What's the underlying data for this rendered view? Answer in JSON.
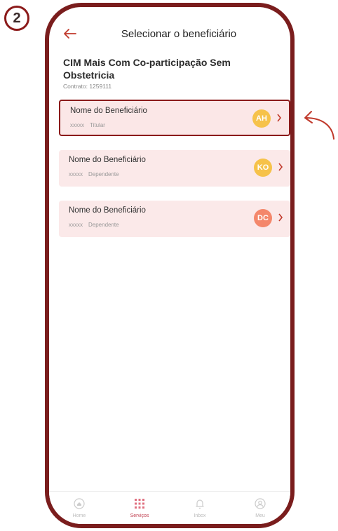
{
  "step": "2",
  "header": {
    "title": "Selecionar o beneficiário"
  },
  "plan": {
    "name": "CIM Mais Com Co-participação Sem Obstetricia",
    "contract": "Contrato: 1259111"
  },
  "beneficiaries": [
    {
      "name": "Nome do Beneficiário",
      "code": "xxxxx",
      "role": "Titular",
      "initials": "AH",
      "selected": true
    },
    {
      "name": "Nome do Beneficiário",
      "code": "xxxxx",
      "role": "Dependente",
      "initials": "KO",
      "selected": false
    },
    {
      "name": "Nome do Beneficiário",
      "code": "xxxxx",
      "role": "Dependente",
      "initials": "DC",
      "selected": false
    }
  ],
  "tabs": [
    {
      "label": "Home",
      "icon": "home-icon"
    },
    {
      "label": "Serviços",
      "icon": "services-grid-icon"
    },
    {
      "label": "Inbox",
      "icon": "bell-icon"
    },
    {
      "label": "Meu",
      "icon": "profile-icon"
    }
  ],
  "colors": {
    "frame": "#7a1d1d",
    "accent": "#c0392b",
    "card_bg": "#fbe9e9",
    "avatar_yellow": "#f6c24a",
    "avatar_coral": "#f4876b"
  }
}
